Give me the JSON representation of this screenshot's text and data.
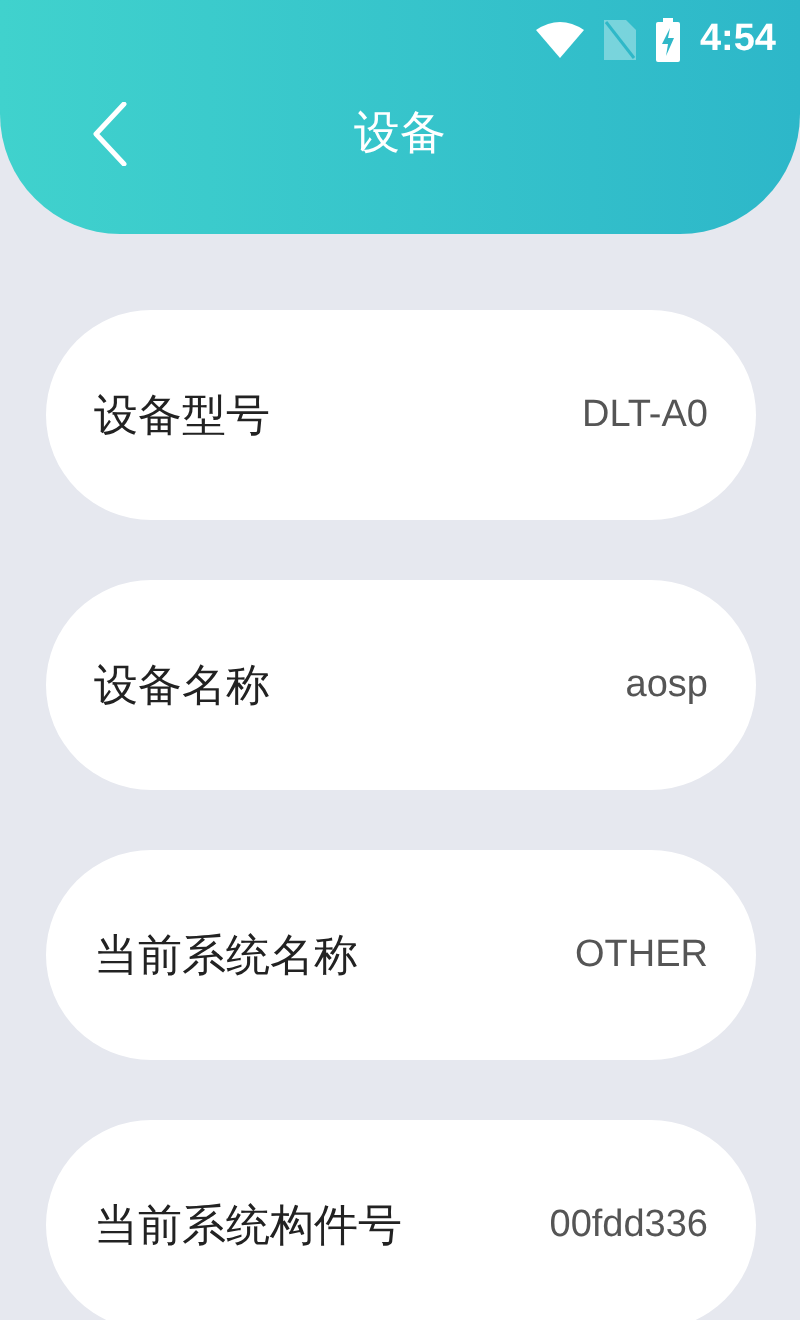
{
  "status_bar": {
    "time": "4:54"
  },
  "header": {
    "title": "设备"
  },
  "rows": [
    {
      "label": "设备型号",
      "value": "DLT-A0"
    },
    {
      "label": "设备名称",
      "value": "aosp"
    },
    {
      "label": "当前系统名称",
      "value": "OTHER"
    },
    {
      "label": "当前系统构件号",
      "value": "00fdd336"
    }
  ]
}
